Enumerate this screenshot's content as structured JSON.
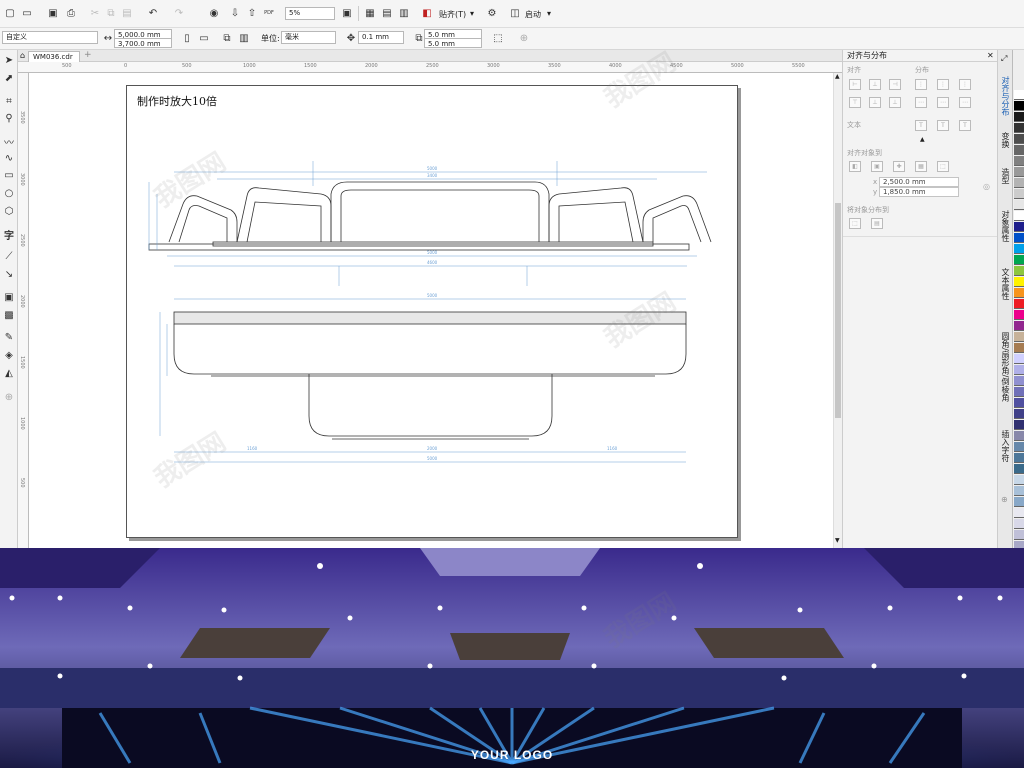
{
  "toolbar": {
    "zoom": "5%",
    "snap_label": "贴齐(T)",
    "launch_label": "启动",
    "pdf_label": "PDF"
  },
  "propbar": {
    "preset": "自定义",
    "width": "5,000.0 mm",
    "height": "3,700.0 mm",
    "unit_label": "单位:",
    "unit_value": "毫米",
    "nudge": "0.1 mm",
    "dup_x": "5.0 mm",
    "dup_y": "5.0 mm"
  },
  "document": {
    "tab_name": "WM036.cdr",
    "page_note": "制作时放大10倍"
  },
  "ruler": {
    "h_ticks": [
      "500",
      "0",
      "500",
      "1000",
      "1500",
      "2000",
      "2500",
      "3000",
      "3500",
      "4000",
      "4500",
      "5000",
      "5500"
    ],
    "v_ticks": [
      "3500",
      "3000",
      "2500",
      "2000",
      "1500",
      "1000",
      "500"
    ]
  },
  "docker": {
    "title": "对齐与分布",
    "sections": {
      "align": "对齐",
      "distribute": "分布",
      "text": "文本",
      "align_to": "对齐对象到",
      "distribute_to": "将对象分布到"
    },
    "coord_x": "2,500.0 mm",
    "coord_y": "1,850.0 mm"
  },
  "side_tabs": [
    "对齐与分布",
    "变换",
    "造型",
    "对象属性",
    "文本属性",
    "圆角/扇形角/倒棱角",
    "插入字符"
  ],
  "palette": [
    "#ffffff",
    "#000000",
    "#1a1a1a",
    "#333333",
    "#4d4d4d",
    "#666666",
    "#808080",
    "#999999",
    "#b3b3b3",
    "#cccccc",
    "#e6e6e6",
    "#ffffff",
    "#1f1f8c",
    "#0050c8",
    "#00a0e9",
    "#00a651",
    "#8dc63f",
    "#fff200",
    "#f7941d",
    "#ed1c24",
    "#ec008c",
    "#92278f",
    "#c7b299",
    "#a67c52",
    "#d0d0ff",
    "#b0b0e8",
    "#9090d0",
    "#7070b8",
    "#5050a0",
    "#404088",
    "#303070",
    "#8888aa",
    "#6688aa",
    "#4d7799",
    "#3a6a8a",
    "#c8d8e8",
    "#a8c0d8",
    "#88a8c8",
    "#e8e8f0",
    "#d8d8e8",
    "#c0c0d8",
    "#a8a8c8"
  ],
  "render": {
    "logo_text": "YOUR LOGO"
  }
}
